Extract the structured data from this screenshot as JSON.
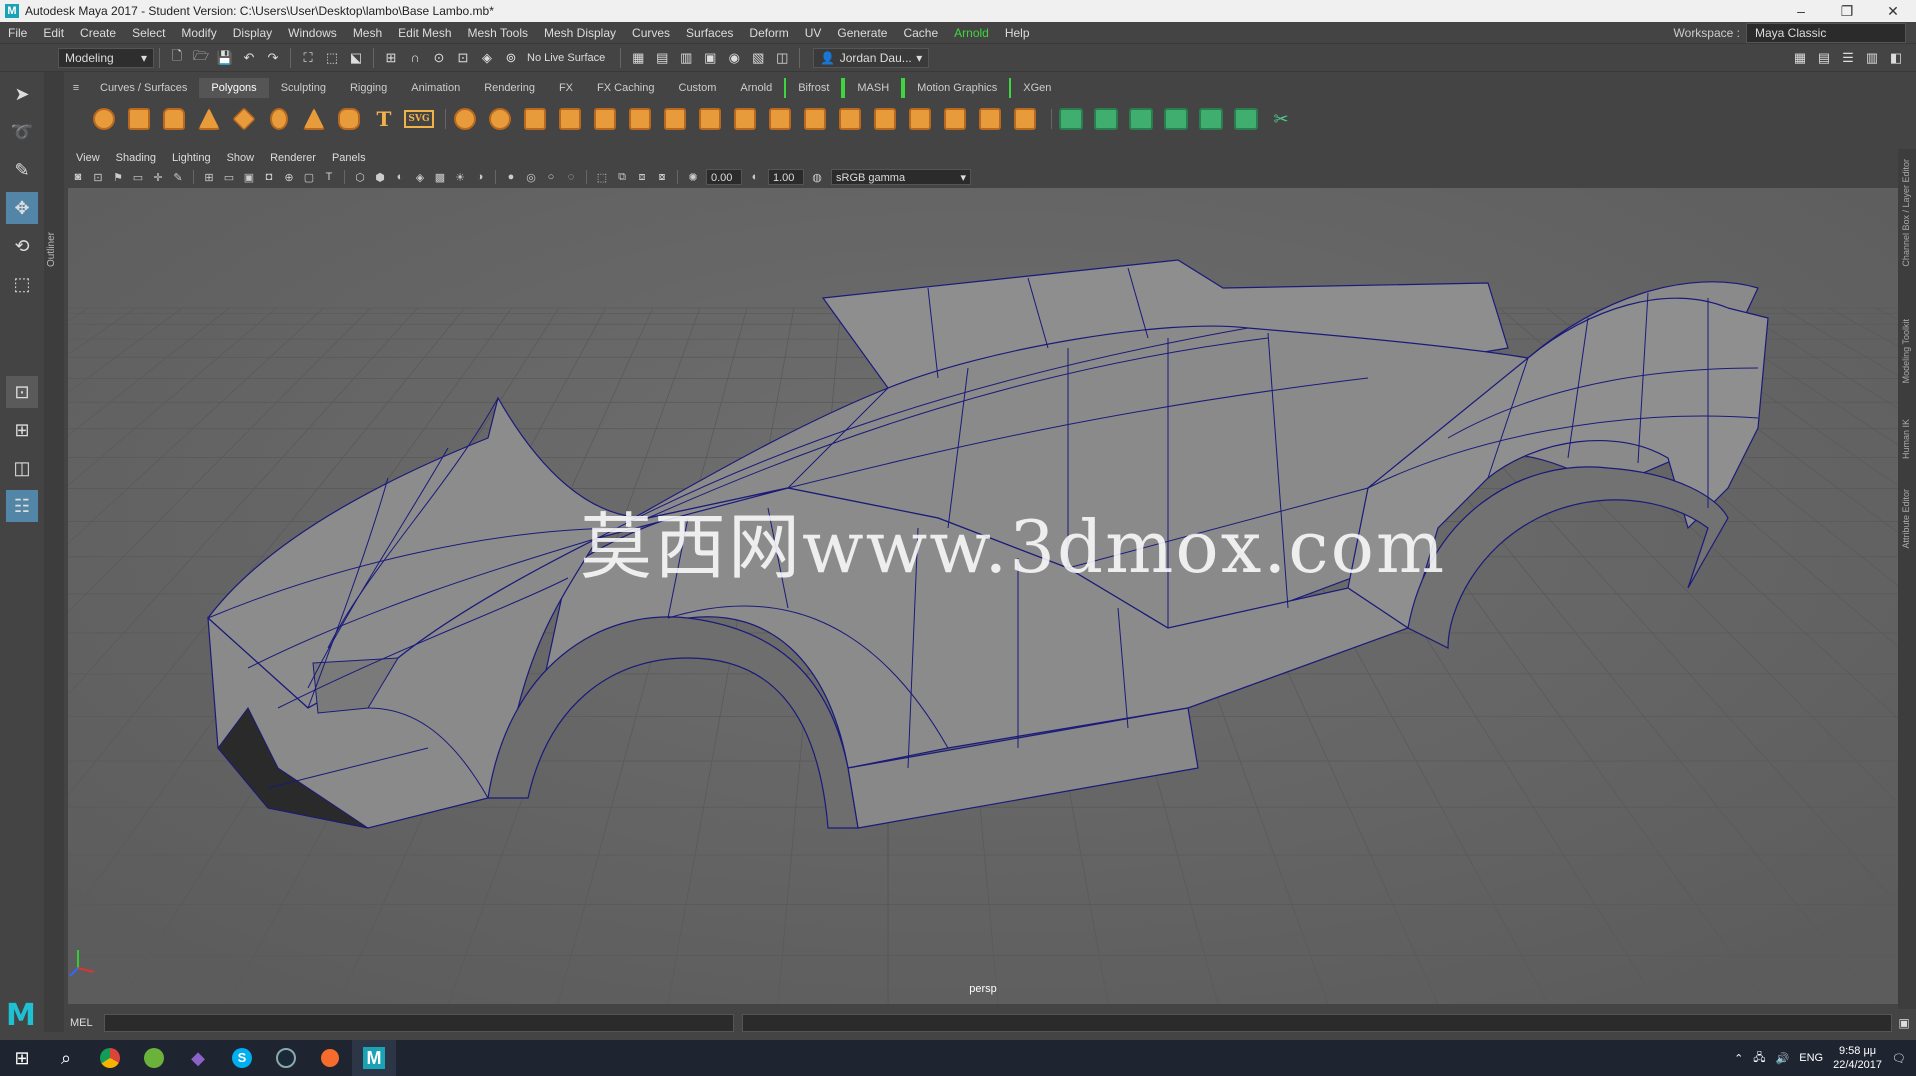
{
  "window": {
    "title": "Autodesk Maya 2017 - Student Version: C:\\Users\\User\\Desktop\\lambo\\Base Lambo.mb*",
    "logo_letter": "M",
    "minimize": "–",
    "restore": "❐",
    "close": "✕"
  },
  "menubar": {
    "items": [
      "File",
      "Edit",
      "Create",
      "Select",
      "Modify",
      "Display",
      "Windows",
      "Mesh",
      "Edit Mesh",
      "Mesh Tools",
      "Mesh Display",
      "Curves",
      "Surfaces",
      "Deform",
      "UV",
      "Generate",
      "Cache",
      "Arnold",
      "Help"
    ],
    "workspace_label": "Workspace :",
    "workspace_value": "Maya Classic"
  },
  "statusline": {
    "mode": "Modeling",
    "live_surface": "No Live Surface",
    "user": "Jordan Dau..."
  },
  "shelf": {
    "tabs": [
      "Curves / Surfaces",
      "Polygons",
      "Sculpting",
      "Rigging",
      "Animation",
      "Rendering",
      "FX",
      "FX Caching",
      "Custom",
      "Arnold",
      "Bifrost",
      "MASH",
      "Motion Graphics",
      "XGen"
    ],
    "active_tab": "Polygons",
    "text_tool": "T",
    "svg_tool": "SVG"
  },
  "panel": {
    "menus": [
      "View",
      "Shading",
      "Lighting",
      "Show",
      "Renderer",
      "Panels"
    ],
    "exposure": "0.00",
    "gamma": "1.00",
    "color_space": "sRGB gamma",
    "camera": "persp"
  },
  "viewport": {
    "watermark": "莫西网www.3dmox.com",
    "grid_color": "#5a5a5a",
    "mesh_fill": "#8c8c8c",
    "wire_color": "#1a1a7a"
  },
  "side_panels": [
    "Channel Box / Layer Editor",
    "Modeling Toolkit",
    "Human IK",
    "Attribute Editor"
  ],
  "outliner_label": "Outliner",
  "cmdline": {
    "language": "MEL"
  },
  "taskbar": {
    "language": "ENG",
    "time": "9:58 μμ",
    "date": "22/4/2017"
  }
}
